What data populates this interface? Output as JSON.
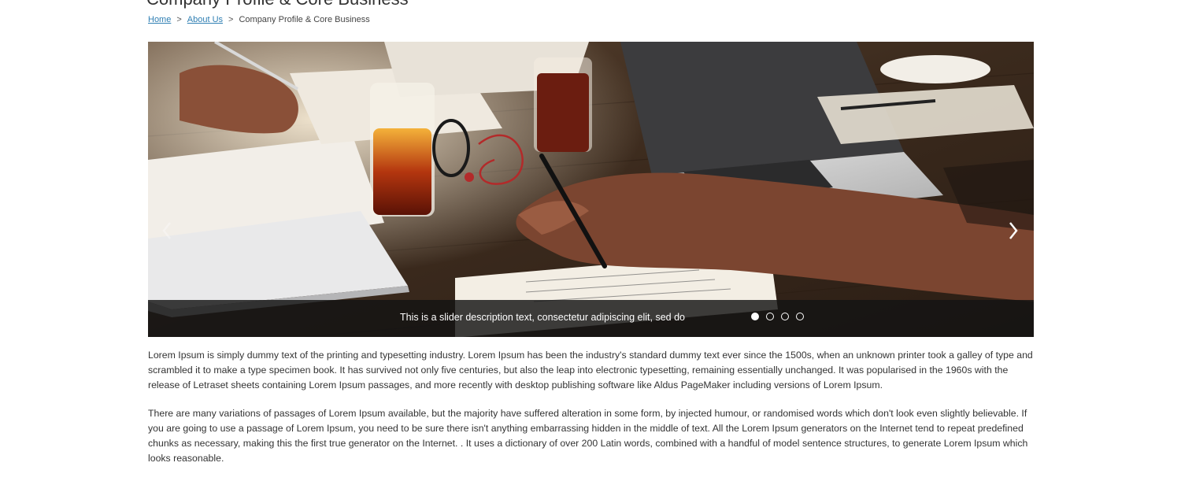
{
  "page": {
    "title": "Company Profile & Core Business"
  },
  "breadcrumb": {
    "home": "Home",
    "separator": ">",
    "about": "About Us",
    "current": "Company Profile & Core Business"
  },
  "slider": {
    "caption": "This is a slider description text, consectetur adipiscing elit, sed do",
    "slide_count": 4,
    "active_index": 0,
    "prev_icon": "chevron-left-icon",
    "next_icon": "chevron-right-icon"
  },
  "content": {
    "paragraphs": [
      "Lorem Ipsum is simply dummy text of the printing and typesetting industry. Lorem Ipsum has been the industry's standard dummy text ever since the 1500s, when an unknown printer took a galley of type and scrambled it to make a type specimen book. It has survived not only five centuries, but also the leap into electronic typesetting, remaining essentially unchanged. It was popularised in the 1960s with the release of Letraset sheets containing Lorem Ipsum passages, and more recently with desktop publishing software like Aldus PageMaker including versions of Lorem Ipsum.",
      "There are many variations of passages of Lorem Ipsum available, but the majority have suffered alteration in some form, by injected humour, or randomised words which don't look even slightly believable. If you are going to use a passage of Lorem Ipsum, you need to be sure there isn't anything embarrassing hidden in the middle of text. All the Lorem Ipsum generators on the Internet tend to repeat predefined chunks as necessary, making this the first true generator on the Internet. . It uses a dictionary of over 200 Latin words, combined with a handful of model sentence structures, to generate Lorem Ipsum which looks reasonable."
    ]
  },
  "colors": {
    "link": "#2f7fb3",
    "text": "#333333",
    "caption_bg": "#141414"
  }
}
